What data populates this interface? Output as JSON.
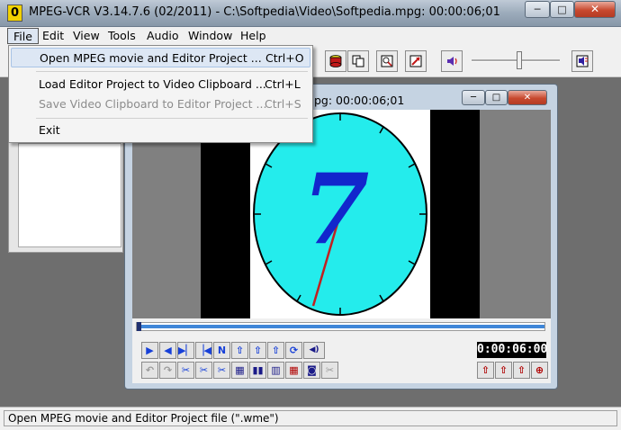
{
  "window": {
    "title": "MPEG-VCR V3.14.7.6 (02/2011) - C:\\Softpedia\\Video\\Softpedia.mpg: 00:00:06;01",
    "minimize": "─",
    "maximize": "□",
    "close": "✕"
  },
  "menu": [
    "File",
    "Edit",
    "View",
    "Tools",
    "Audio",
    "Window",
    "Help"
  ],
  "file_menu": {
    "open": {
      "label": "Open MPEG movie and Editor Project ...",
      "shortcut": "Ctrl+O"
    },
    "load": {
      "label": "Load Editor Project to Video Clipboard ...",
      "shortcut": "Ctrl+L"
    },
    "save": {
      "label": "Save Video Clipboard to Editor Project ...",
      "shortcut": "Ctrl+S"
    },
    "exit": {
      "label": "Exit"
    }
  },
  "video_window": {
    "title": "pg: 00:00:06;01",
    "clock_digit": "7",
    "timecode": "0:00:06:00",
    "seek_position": 0
  },
  "controls": {
    "row1": [
      "▶",
      "◀",
      "▶▏",
      "▕◀",
      "N",
      "⇧",
      "⇧",
      "⇧",
      "⟳",
      "◀)"
    ],
    "row2": [
      "↶",
      "↷",
      "✂",
      "✂",
      "✂",
      "▦",
      "▮▮",
      "▥",
      "▦",
      "◙",
      "✂"
    ],
    "mark": [
      "⇧",
      "⇧",
      "⇧",
      "⊕"
    ]
  },
  "status": {
    "text": "Open MPEG movie and Editor Project file (\".wme\")"
  },
  "colors": {
    "clock_face": "#24ecec",
    "digit": "#1226cc",
    "hand": "#c02020"
  }
}
